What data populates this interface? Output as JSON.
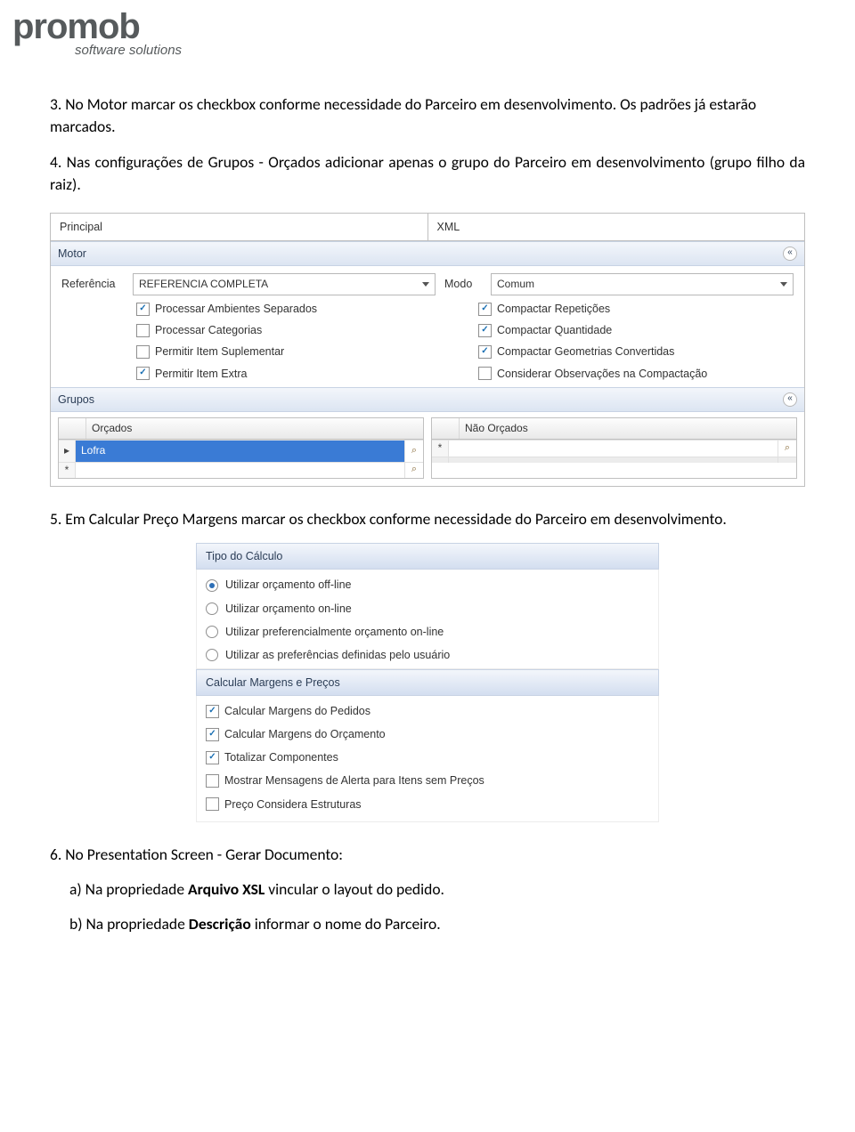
{
  "logo": {
    "main": "promob",
    "sub": "software solutions"
  },
  "para3": "3. No Motor marcar os checkbox conforme necessidade do Parceiro em desenvolvimento. Os padrões já estarão marcados.",
  "para4": "4. Nas configurações de Grupos - Orçados adicionar apenas o grupo do Parceiro em desenvolvimento (grupo filho da raiz).",
  "fig1": {
    "tabs": {
      "t1": "Principal",
      "t2": "XML"
    },
    "motor": {
      "title": "Motor",
      "refLabel": "Referência",
      "refValue": "REFERENCIA COMPLETA",
      "modoLabel": "Modo",
      "modoValue": "Comum",
      "left": [
        {
          "label": "Processar Ambientes Separados",
          "checked": true
        },
        {
          "label": "Processar Categorias",
          "checked": false
        },
        {
          "label": "Permitir Item Suplementar",
          "checked": false
        },
        {
          "label": "Permitir Item Extra",
          "checked": true
        }
      ],
      "right": [
        {
          "label": "Compactar Repetições",
          "checked": true
        },
        {
          "label": "Compactar Quantidade",
          "checked": true
        },
        {
          "label": "Compactar Geometrias Convertidas",
          "checked": true
        },
        {
          "label": "Considerar Observações na Compactação",
          "checked": false
        }
      ]
    },
    "grupos": {
      "title": "Grupos",
      "orcHead": "Orçados",
      "orcRow": "Lofra",
      "naoHead": "Não Orçados"
    }
  },
  "para5": "5. Em Calcular Preço Margens marcar os checkbox conforme necessidade do Parceiro em desenvolvimento.",
  "fig2": {
    "sec1": "Tipo do Cálculo",
    "radios": [
      {
        "label": "Utilizar orçamento off-line",
        "on": true
      },
      {
        "label": "Utilizar orçamento on-line",
        "on": false
      },
      {
        "label": "Utilizar preferencialmente orçamento on-line",
        "on": false
      },
      {
        "label": "Utilizar as preferências definidas pelo usuário",
        "on": false
      }
    ],
    "sec2": "Calcular Margens e Preços",
    "checks": [
      {
        "label": "Calcular Margens do Pedidos",
        "checked": true
      },
      {
        "label": "Calcular Margens do Orçamento",
        "checked": true
      },
      {
        "label": "Totalizar Componentes",
        "checked": true
      },
      {
        "label": "Mostrar Mensagens de Alerta para Itens sem Preços",
        "checked": false
      },
      {
        "label": "Preço Considera Estruturas",
        "checked": false
      }
    ]
  },
  "para6": "6. No Presentation Screen - Gerar Documento:",
  "para6a_pre": "a) Na propriedade ",
  "para6a_bold": "Arquivo XSL",
  "para6a_post": " vincular o layout do pedido.",
  "para6b_pre": "b) Na propriedade ",
  "para6b_bold": "Descrição",
  "para6b_post": " informar o nome do Parceiro."
}
